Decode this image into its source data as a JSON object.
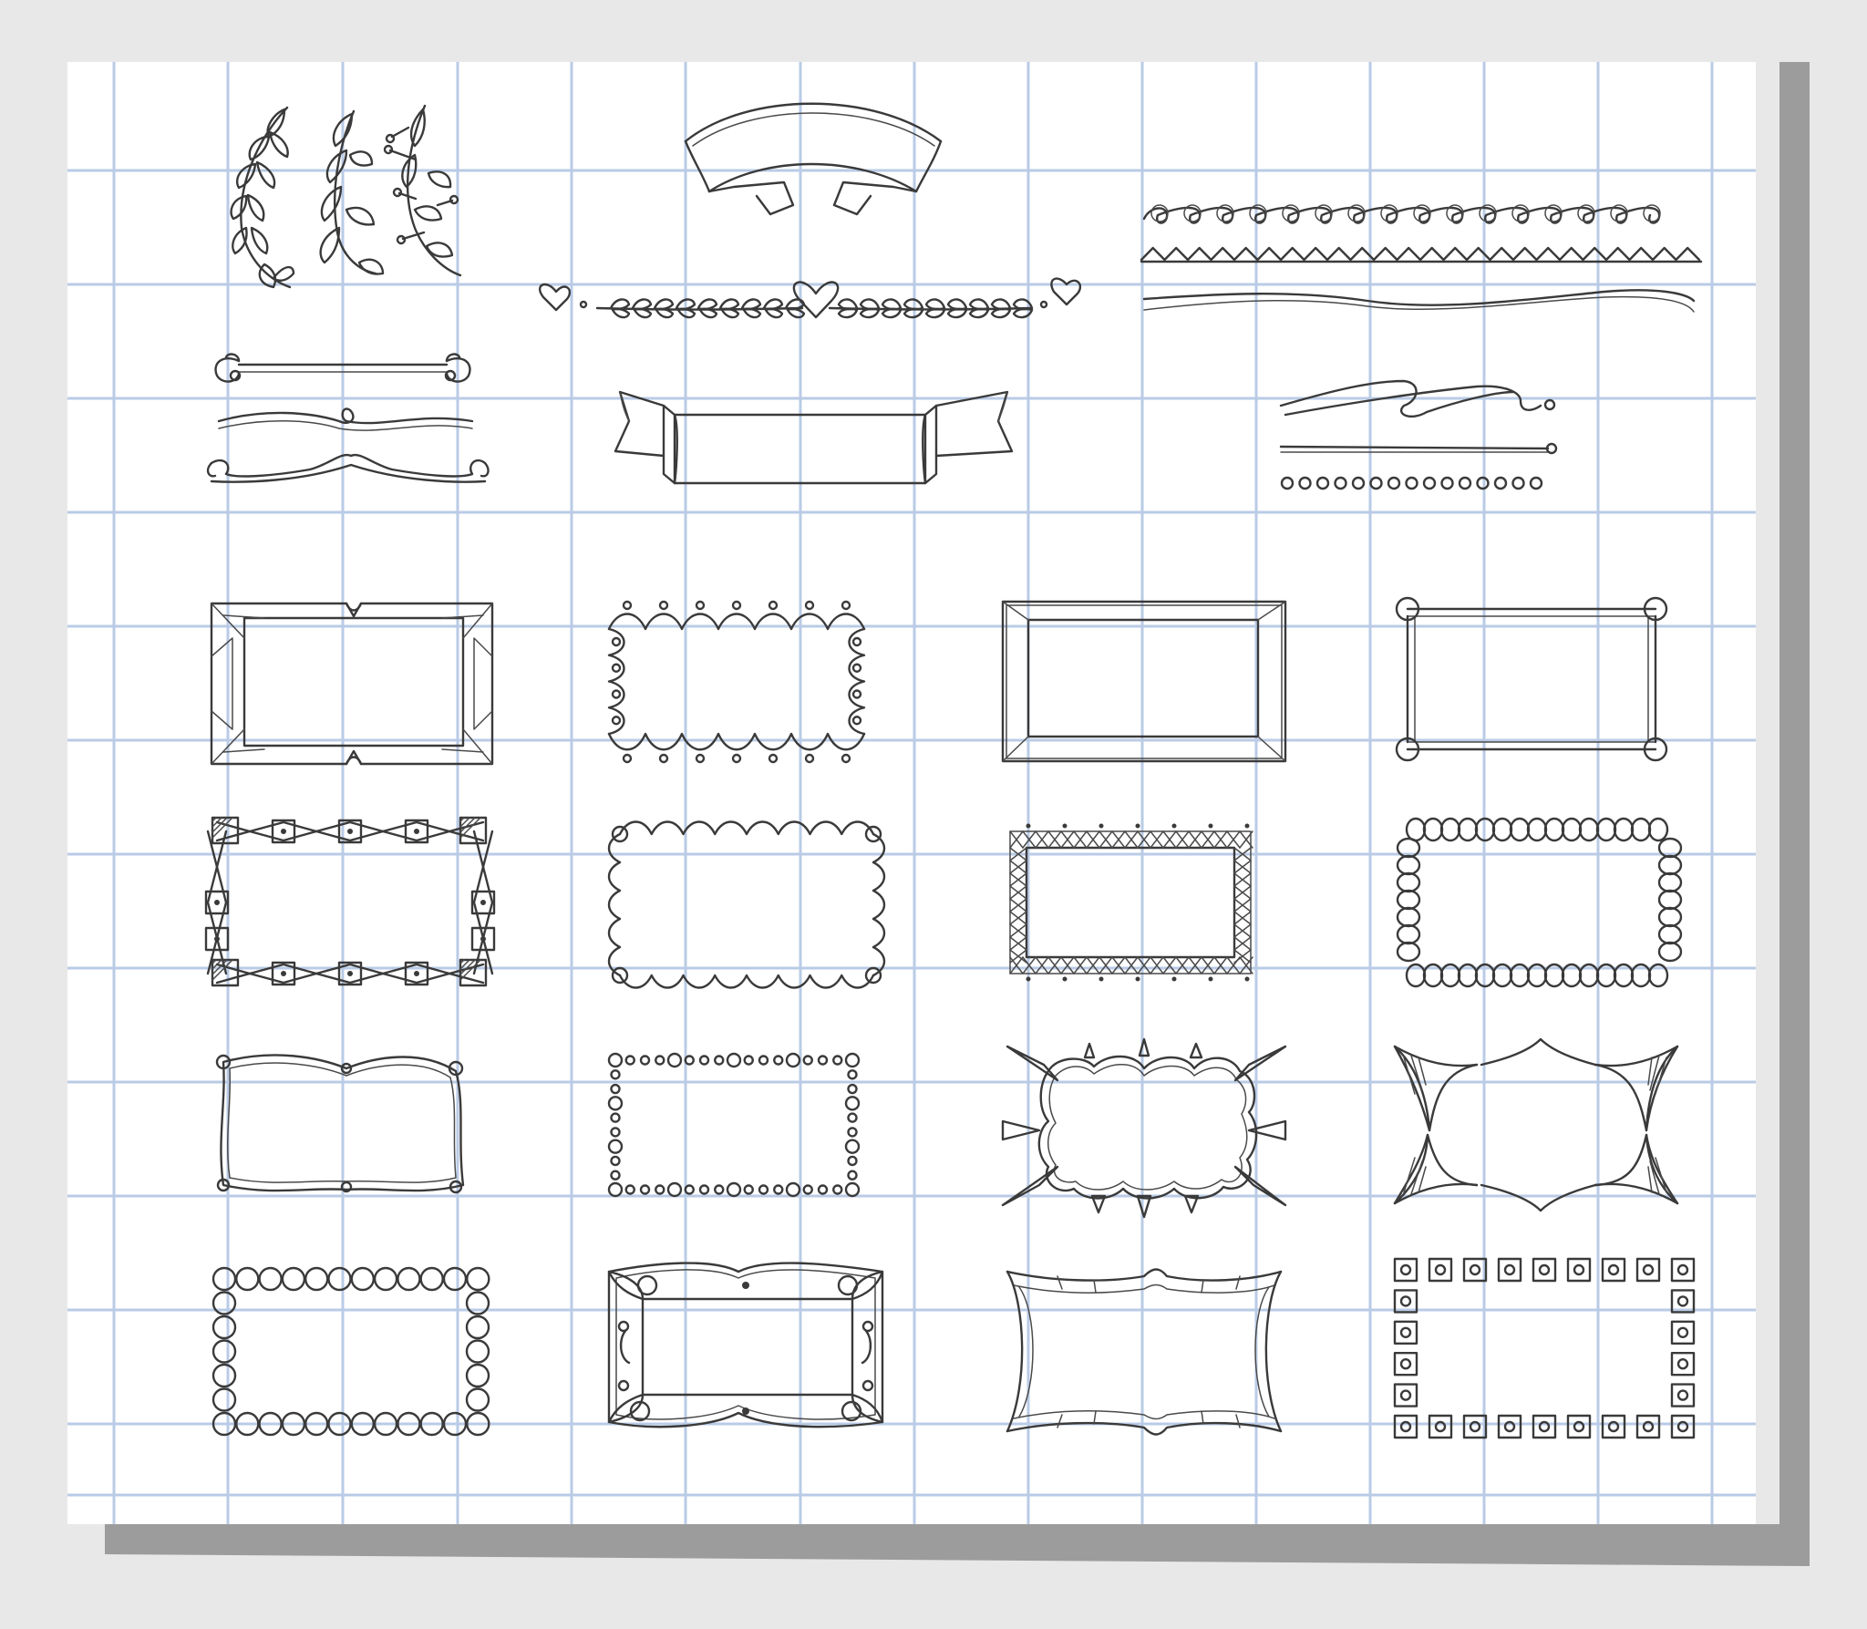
{
  "colors": {
    "background": "#e8e8e8",
    "paper": "#ffffff",
    "paper_shadow": "#9c9c9c",
    "grid": "#b9cbe6",
    "ink": "#3a3a3a"
  },
  "grid": {
    "vertical_lines": 15,
    "horizontal_lines": 13
  },
  "elements": {
    "decorations_row_1": [
      "laurel-branch-icon",
      "leafy-sprig-icon",
      "berry-sprig-icon",
      "ribbon-banner-icon",
      "loop-divider-icon",
      "zigzag-divider-icon",
      "wavy-double-line-icon"
    ],
    "decorations_row_2": [
      "heart-laurel-divider-icon",
      "scroll-bar-divider-icon",
      "flourish-divider-icon",
      "folded-ribbon-banner-icon",
      "swoosh-line-icon",
      "pin-line-icon",
      "dotted-divider-icon"
    ],
    "frames": [
      "ornate-corner-frame-icon",
      "scalloped-frame-icon",
      "double-line-frame-icon",
      "ball-corner-frame-icon",
      "bowtie-frame-icon",
      "wavy-frame-icon",
      "crosshatch-frame-icon",
      "loop-chain-frame-icon",
      "curvy-pin-frame-icon",
      "dotted-circle-frame-icon",
      "spiky-cloud-frame-icon",
      "thorn-corner-frame-icon",
      "circle-chain-frame-icon",
      "baroque-frame-icon",
      "bracket-scroll-frame-icon",
      "square-tile-frame-icon"
    ]
  }
}
